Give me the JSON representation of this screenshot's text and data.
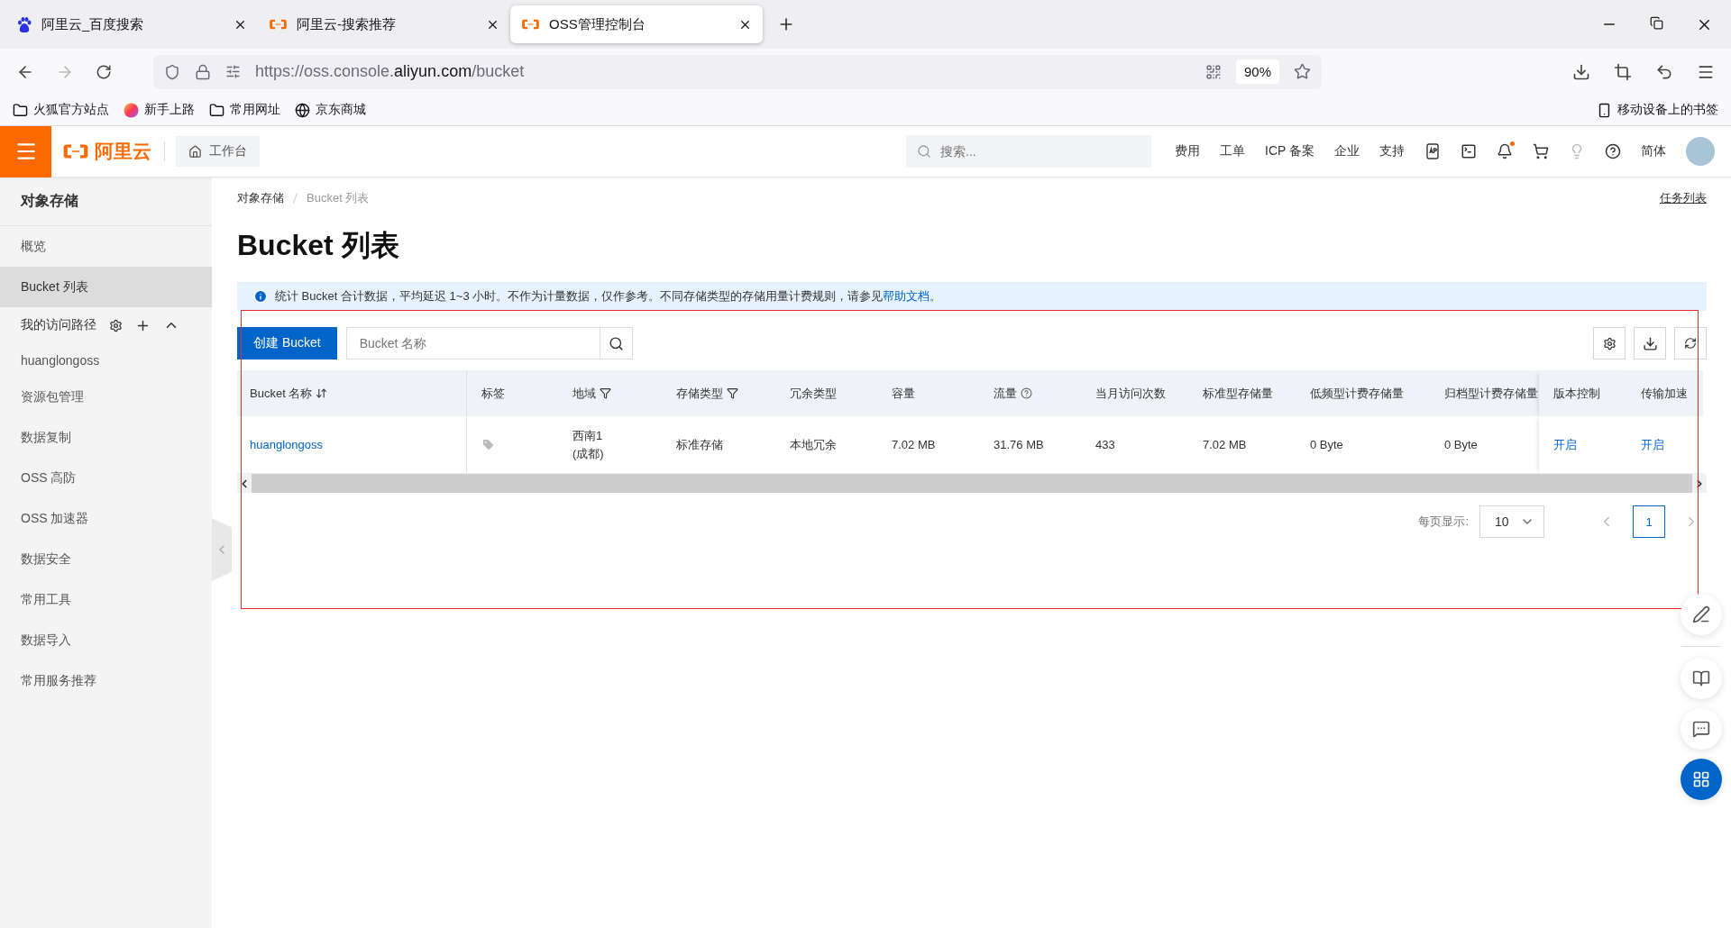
{
  "browser": {
    "tabs": [
      {
        "title": "阿里云_百度搜索",
        "kind": "paw",
        "selected": false
      },
      {
        "title": "阿里云-搜索推荐",
        "kind": "aliyun",
        "selected": false
      },
      {
        "title": "OSS管理控制台",
        "kind": "aliyun",
        "selected": true
      }
    ],
    "url": {
      "prefix": "https://oss.console.",
      "domain": "aliyun.com",
      "path": "/bucket"
    },
    "zoom": "90%",
    "bookmarks": [
      {
        "label": "火狐官方站点",
        "kind": "folder"
      },
      {
        "label": "新手上路",
        "kind": "firefox"
      },
      {
        "label": "常用网址",
        "kind": "folder"
      },
      {
        "label": "京东商城",
        "kind": "globe"
      }
    ],
    "mobile_bookmarks": "移动设备上的书签"
  },
  "header": {
    "brand": "阿里云",
    "workbench": "工作台",
    "search": {
      "placeholder": "搜索..."
    },
    "links": [
      "费用",
      "工单",
      "ICP 备案",
      "企业",
      "支持"
    ],
    "notifications_unread": true,
    "language": "简体"
  },
  "sidebar": {
    "title": "对象存储",
    "items": [
      {
        "label": "概览",
        "selected": false
      },
      {
        "label": "Bucket 列表",
        "selected": true
      }
    ],
    "access_paths": {
      "label": "我的访问路径",
      "expanded": true,
      "items": [
        "huanglongoss"
      ]
    },
    "more_items": [
      {
        "label": "资源包管理",
        "selected": false
      },
      {
        "label": "数据复制",
        "selected": false
      },
      {
        "label": "OSS 高防",
        "selected": false
      },
      {
        "label": "OSS 加速器",
        "selected": false
      },
      {
        "label": "数据安全",
        "selected": false
      },
      {
        "label": "常用工具",
        "selected": false
      },
      {
        "label": "数据导入",
        "selected": false
      },
      {
        "label": "常用服务推荐",
        "selected": false
      }
    ]
  },
  "breadcrumb": [
    "对象存储",
    "Bucket 列表"
  ],
  "task_list": "任务列表",
  "page_title": "Bucket 列表",
  "notice": {
    "text": "统计 Bucket 合计数据，平均延迟 1~3 小时。不作为计量数据，仅作参考。不同存储类型的存储用量计费规则，请参见",
    "link": "帮助文档",
    "tail": "。"
  },
  "toolbar": {
    "create_button": "创建 Bucket",
    "search": {
      "placeholder": "Bucket 名称"
    }
  },
  "table": {
    "columns": [
      {
        "label": "Bucket 名称",
        "kind": "sortable"
      },
      {
        "label": "标签",
        "kind": "plain"
      },
      {
        "label": "地域",
        "kind": "filterable"
      },
      {
        "label": "存储类型",
        "kind": "filterable"
      },
      {
        "label": "冗余类型",
        "kind": "plain"
      },
      {
        "label": "容量",
        "kind": "plain"
      },
      {
        "label": "流量",
        "kind": "help"
      },
      {
        "label": "当月访问次数",
        "kind": "plain"
      },
      {
        "label": "标准型存储量",
        "kind": "plain"
      },
      {
        "label": "低频型计费存储量",
        "kind": "plain"
      },
      {
        "label": "归档型计费存储量",
        "kind": "plain"
      },
      {
        "label": "版本控制",
        "kind": "plain"
      },
      {
        "label": "传输加速",
        "kind": "plain"
      }
    ],
    "rows": [
      {
        "cells": [
          {
            "kind": "link",
            "text": "huanglongoss"
          },
          {
            "kind": "tag"
          },
          {
            "kind": "text",
            "text": "西南1\n(成都)"
          },
          {
            "kind": "text",
            "text": "标准存储"
          },
          {
            "kind": "text",
            "text": "本地冗余"
          },
          {
            "kind": "text",
            "text": "7.02 MB"
          },
          {
            "kind": "text",
            "text": "31.76 MB"
          },
          {
            "kind": "text",
            "text": "433"
          },
          {
            "kind": "text",
            "text": "7.02 MB"
          },
          {
            "kind": "text",
            "text": "0 Byte"
          },
          {
            "kind": "text",
            "text": "0 Byte"
          },
          {
            "kind": "link",
            "text": "开启"
          },
          {
            "kind": "link",
            "text": "开启"
          }
        ]
      }
    ]
  },
  "pagination": {
    "page_size_label": "每页显示:",
    "page_size": "10",
    "pages": [
      {
        "label": "1",
        "selected": true
      }
    ]
  }
}
